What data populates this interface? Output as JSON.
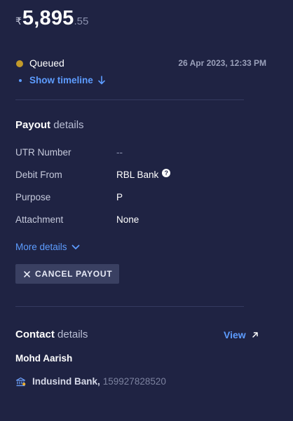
{
  "payout": {
    "currency_symbol": "₹",
    "amount_main": "5,895",
    "amount_fraction": ".55"
  },
  "status": {
    "label": "Queued",
    "timestamp": "26 Apr 2023, 12:33 PM",
    "timeline_link": "Show timeline",
    "dot_color": "#c29a2a"
  },
  "payout_details": {
    "title_strong": "Payout",
    "title_rest": "details",
    "rows": [
      {
        "key": "UTR Number",
        "value": "--"
      },
      {
        "key": "Debit From",
        "value": "RBL Bank"
      },
      {
        "key": "Purpose",
        "value": "P"
      },
      {
        "key": "Attachment",
        "value": "None"
      }
    ],
    "help_glyph": "?",
    "more_details": "More details",
    "cancel_button": "CANCEL PAYOUT"
  },
  "contact_details": {
    "title_strong": "Contact",
    "title_rest": "details",
    "view_link": "View",
    "name": "Mohd Aarish",
    "bank_name": "Indusind Bank,",
    "account_number": "159927828520"
  },
  "colors": {
    "background": "#1f2343",
    "accent_link": "#5d9cff",
    "divider": "#353a60",
    "button_bg": "#3a4062"
  },
  "icons": {
    "arrow_down": "arrow-down-icon",
    "chevron_down": "chevron-down-icon",
    "close": "close-icon",
    "external_link": "external-link-icon",
    "bank": "bank-icon",
    "help": "help-circle-icon"
  }
}
